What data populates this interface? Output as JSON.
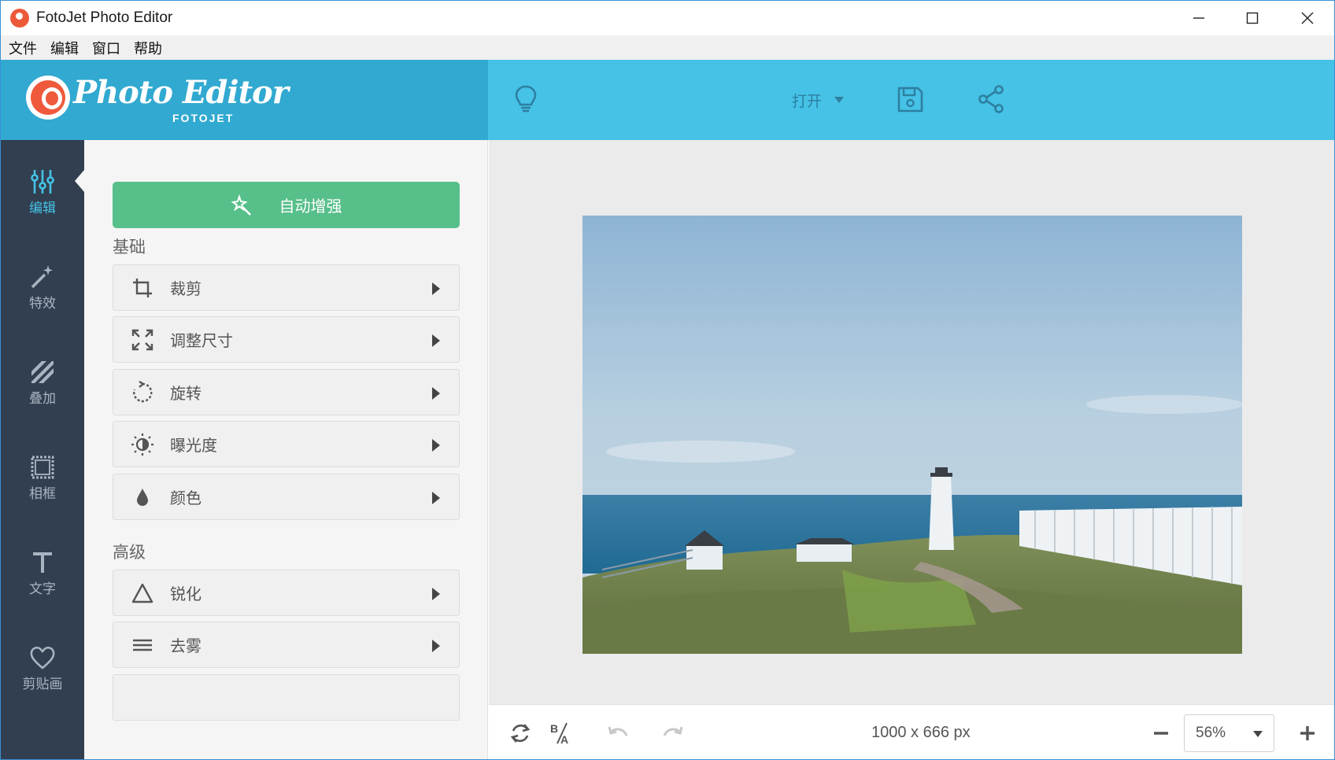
{
  "window": {
    "title": "FotoJet Photo Editor"
  },
  "menu": [
    "文件",
    "编辑",
    "窗口",
    "帮助"
  ],
  "brand": {
    "logo_text": "Photo Editor",
    "logo_sub": "FOTOJET"
  },
  "toolbar": {
    "open_label": "打开",
    "icons": [
      "lightbulb-icon",
      "save-icon",
      "share-icon"
    ]
  },
  "rail": {
    "items": [
      {
        "label": "编辑",
        "icon": "sliders-icon",
        "active": true
      },
      {
        "label": "特效",
        "icon": "magic-wand-icon",
        "active": false
      },
      {
        "label": "叠加",
        "icon": "stripes-icon",
        "active": false
      },
      {
        "label": "相框",
        "icon": "frame-icon",
        "active": false
      },
      {
        "label": "文字",
        "icon": "text-icon",
        "active": false
      },
      {
        "label": "剪贴画",
        "icon": "heart-icon",
        "active": false
      }
    ]
  },
  "panel": {
    "auto_enhance_label": "自动增强",
    "basic_title": "基础",
    "basic_tools": [
      {
        "label": "裁剪",
        "icon": "crop-icon"
      },
      {
        "label": "调整尺寸",
        "icon": "resize-icon"
      },
      {
        "label": "旋转",
        "icon": "rotate-icon"
      },
      {
        "label": "曝光度",
        "icon": "exposure-icon"
      },
      {
        "label": "颜色",
        "icon": "drop-icon"
      }
    ],
    "advanced_title": "高级",
    "advanced_tools": [
      {
        "label": "锐化",
        "icon": "triangle-icon"
      },
      {
        "label": "去雾",
        "icon": "lines-icon"
      }
    ]
  },
  "canvas": {
    "image_description_icon": "lighthouse-photo"
  },
  "bottombar": {
    "dimensions": "1000 x 666 px",
    "zoom": "56%",
    "icons": [
      "reset-icon",
      "before-after-icon",
      "undo-icon",
      "redo-icon",
      "zoom-out-icon",
      "zoom-in-icon"
    ]
  },
  "colors": {
    "accent": "#45c2e6",
    "brand_dark": "#31a9d0",
    "rail": "#323f50",
    "enhance": "#57bf8a"
  }
}
